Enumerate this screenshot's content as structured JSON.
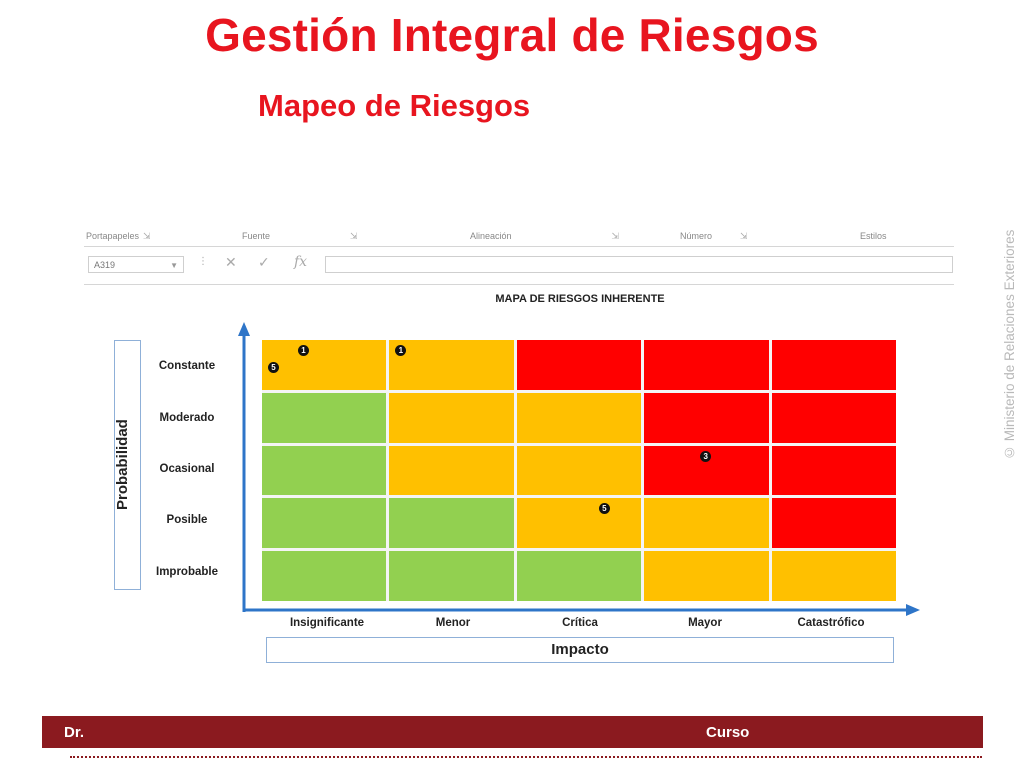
{
  "slide": {
    "title": "Gestión Integral de Riesgos",
    "subtitle": "Mapeo de Riesgos",
    "watermark": "© Ministerio de Relaciones Exteriores"
  },
  "toolbar": {
    "fields": [
      {
        "label": "Portapapeles",
        "dd": "⇲"
      },
      {
        "label": "Fuente",
        "dd": "⇲"
      },
      {
        "label": "Alineación",
        "dd": "⇲"
      },
      {
        "label": "Número",
        "dd": "⇲"
      },
      {
        "label": "Estilos",
        "dd": ""
      }
    ],
    "namebox": "A319"
  },
  "risk_map": {
    "title": "MAPA DE RIESGOS INHERENTE",
    "y_axis_label": "Probabilidad",
    "x_axis_label": "Impacto",
    "probability_levels": [
      "Constante",
      "Moderado",
      "Ocasional",
      "Posible",
      "Improbable"
    ],
    "impact_levels": [
      "Insignificante",
      "Menor",
      "Crítica",
      "Mayor",
      "Catastrófico"
    ],
    "colors": {
      "green": "#92d050",
      "yellow": "#ffc000",
      "red": "#ff0000"
    },
    "cells": [
      [
        "yellow",
        "yellow",
        "red",
        "red",
        "red"
      ],
      [
        "green",
        "yellow",
        "yellow",
        "red",
        "red"
      ],
      [
        "green",
        "yellow",
        "yellow",
        "red",
        "red"
      ],
      [
        "green",
        "green",
        "yellow",
        "yellow",
        "red"
      ],
      [
        "green",
        "green",
        "green",
        "yellow",
        "yellow"
      ]
    ],
    "markers": [
      {
        "row": 0,
        "col": 0,
        "label": "1"
      },
      {
        "row": 0,
        "col": 0,
        "label": "5"
      },
      {
        "row": 0,
        "col": 1,
        "label": "1"
      },
      {
        "row": 2,
        "col": 3,
        "label": "3"
      },
      {
        "row": 3,
        "col": 2,
        "label": "5"
      }
    ]
  },
  "footer": {
    "left": "Dr.",
    "right": "Curso",
    "color": "#8b1a1f"
  }
}
